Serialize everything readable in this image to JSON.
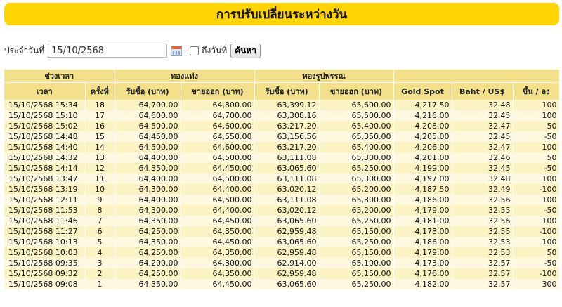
{
  "title": "การปรับเปลี่ยนระหว่างวัน",
  "filter": {
    "date_label": "ประจำวันที่",
    "date_value": "15/10/2568",
    "to_label": "ถึงวันที่",
    "search_label": "ค้นหา"
  },
  "headers": {
    "group_time": "ช่วงเวลา",
    "group_bar": "ทองแท่ง",
    "group_ornament": "ทองรูปพรรณ",
    "time": "เวลา",
    "round": "ครั้งที่",
    "bar_buy": "รับซื้อ (บาท)",
    "bar_sell": "ขายออก (บาท)",
    "orn_buy": "รับซื้อ (บาท)",
    "orn_sell": "ขายออก (บาท)",
    "spot": "Gold Spot",
    "fx": "Baht / US$",
    "change": "ขึ้น / ลง"
  },
  "rows": [
    {
      "time": "15/10/2568 15:34",
      "round": "18",
      "bar_buy": "64,700.00",
      "bar_sell": "64,800.00",
      "orn_buy": "63,399.12",
      "orn_sell": "65,600.00",
      "spot": "4,217.50",
      "fx": "32.48",
      "change": "100"
    },
    {
      "time": "15/10/2568 15:10",
      "round": "17",
      "bar_buy": "64,600.00",
      "bar_sell": "64,700.00",
      "orn_buy": "63,308.16",
      "orn_sell": "65,500.00",
      "spot": "4,216.00",
      "fx": "32.45",
      "change": "100"
    },
    {
      "time": "15/10/2568 15:02",
      "round": "16",
      "bar_buy": "64,500.00",
      "bar_sell": "64,600.00",
      "orn_buy": "63,217.20",
      "orn_sell": "65,400.00",
      "spot": "4,208.00",
      "fx": "32.47",
      "change": "50"
    },
    {
      "time": "15/10/2568 14:48",
      "round": "15",
      "bar_buy": "64,450.00",
      "bar_sell": "64,550.00",
      "orn_buy": "63,156.56",
      "orn_sell": "65,350.00",
      "spot": "4,205.00",
      "fx": "32.45",
      "change": "-50"
    },
    {
      "time": "15/10/2568 14:40",
      "round": "14",
      "bar_buy": "64,500.00",
      "bar_sell": "64,600.00",
      "orn_buy": "63,217.20",
      "orn_sell": "65,400.00",
      "spot": "4,206.00",
      "fx": "32.47",
      "change": "100"
    },
    {
      "time": "15/10/2568 14:32",
      "round": "13",
      "bar_buy": "64,400.00",
      "bar_sell": "64,500.00",
      "orn_buy": "63,111.08",
      "orn_sell": "65,300.00",
      "spot": "4,201.00",
      "fx": "32.46",
      "change": "50"
    },
    {
      "time": "15/10/2568 14:14",
      "round": "12",
      "bar_buy": "64,350.00",
      "bar_sell": "64,450.00",
      "orn_buy": "63,065.60",
      "orn_sell": "65,250.00",
      "spot": "4,199.00",
      "fx": "32.45",
      "change": "-50"
    },
    {
      "time": "15/10/2568 13:47",
      "round": "11",
      "bar_buy": "64,400.00",
      "bar_sell": "64,500.00",
      "orn_buy": "63,111.08",
      "orn_sell": "65,300.00",
      "spot": "4,197.00",
      "fx": "32.48",
      "change": "100"
    },
    {
      "time": "15/10/2568 13:19",
      "round": "10",
      "bar_buy": "64,300.00",
      "bar_sell": "64,400.00",
      "orn_buy": "63,020.12",
      "orn_sell": "65,200.00",
      "spot": "4,187.50",
      "fx": "32.49",
      "change": "-100"
    },
    {
      "time": "15/10/2568 12:11",
      "round": "9",
      "bar_buy": "64,400.00",
      "bar_sell": "64,500.00",
      "orn_buy": "63,111.08",
      "orn_sell": "65,300.00",
      "spot": "4,186.00",
      "fx": "32.56",
      "change": "100"
    },
    {
      "time": "15/10/2568 11:53",
      "round": "8",
      "bar_buy": "64,300.00",
      "bar_sell": "64,400.00",
      "orn_buy": "63,020.12",
      "orn_sell": "65,200.00",
      "spot": "4,179.00",
      "fx": "32.55",
      "change": "-50"
    },
    {
      "time": "15/10/2568 11:46",
      "round": "7",
      "bar_buy": "64,350.00",
      "bar_sell": "64,450.00",
      "orn_buy": "63,065.60",
      "orn_sell": "65,250.00",
      "spot": "4,181.00",
      "fx": "32.56",
      "change": "100"
    },
    {
      "time": "15/10/2568 11:27",
      "round": "6",
      "bar_buy": "64,250.00",
      "bar_sell": "64,350.00",
      "orn_buy": "62,959.48",
      "orn_sell": "65,150.00",
      "spot": "4,178.00",
      "fx": "32.55",
      "change": "-100"
    },
    {
      "time": "15/10/2568 10:13",
      "round": "5",
      "bar_buy": "64,350.00",
      "bar_sell": "64,450.00",
      "orn_buy": "63,065.60",
      "orn_sell": "65,250.00",
      "spot": "4,186.00",
      "fx": "32.53",
      "change": "100"
    },
    {
      "time": "15/10/2568 10:03",
      "round": "4",
      "bar_buy": "64,250.00",
      "bar_sell": "64,350.00",
      "orn_buy": "62,959.48",
      "orn_sell": "65,150.00",
      "spot": "4,179.00",
      "fx": "32.53",
      "change": "50"
    },
    {
      "time": "15/10/2568 09:35",
      "round": "3",
      "bar_buy": "64,200.00",
      "bar_sell": "64,300.00",
      "orn_buy": "62,914.00",
      "orn_sell": "65,100.00",
      "spot": "4,173.00",
      "fx": "32.57",
      "change": "-50"
    },
    {
      "time": "15/10/2568 09:32",
      "round": "2",
      "bar_buy": "64,250.00",
      "bar_sell": "64,350.00",
      "orn_buy": "62,959.48",
      "orn_sell": "65,150.00",
      "spot": "4,176.00",
      "fx": "32.57",
      "change": "-100"
    },
    {
      "time": "15/10/2568 09:08",
      "round": "1",
      "bar_buy": "64,350.00",
      "bar_sell": "64,450.00",
      "orn_buy": "63,065.60",
      "orn_sell": "65,250.00",
      "spot": "4,182.00",
      "fx": "32.57",
      "change": "300"
    }
  ]
}
